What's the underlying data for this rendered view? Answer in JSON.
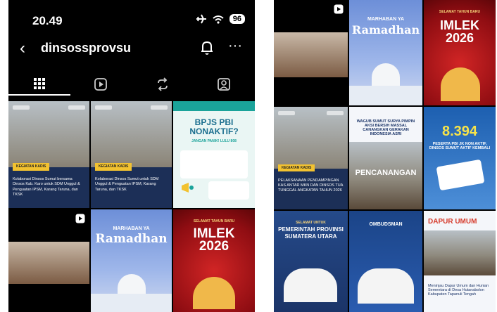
{
  "status": {
    "time": "20.49",
    "battery": "96"
  },
  "header": {
    "username": "dinsossprovsu"
  },
  "tabs": [
    {
      "name": "grid-icon"
    },
    {
      "name": "reels-icon"
    },
    {
      "name": "repost-icon"
    },
    {
      "name": "tagged-icon"
    }
  ],
  "posts": {
    "kegiatan_label": "KEGIATAN KADIS",
    "post1_caption": "Kolaborasi Dinsos Sumut bersama Dinsos Kab. Karo untuk SDM Unggul & Penguatan IPSM, Karang Taruna, dan TKSK",
    "post2_caption": "Kolaborasi Dinsos Sumut untuk SDM Unggul & Penguatan IPSM, Karang Taruna, dan TKSK",
    "bpjs_title": "BPJS PBI NONAKTIF?",
    "bpjs_sub": "JANGAN PANIK! LULU 808",
    "marhaban_1": "MARHABAN YA",
    "marhaban_2": "Ramadhan",
    "imlek_header": "SELAMAT TAHUN BARU",
    "imlek_word": "IMLEK",
    "imlek_year": "2026",
    "wamen_title": "WAGUB SUMUT SURYA PIMPIN AKSI BERSIH MASSAL CANANGKAN GERAKAN INDONESIA ASRI",
    "pencanangan": "PENCANANGAN",
    "stat_value": "8.394",
    "stat_caption": "PESERTA PBI JK NON AKTIF, DINSOS SUMUT AKTIF KEMBALI",
    "pelaksanaan_caption": "PELAKSANAAN PENDAMPINGAN KAS ANTAR MKN DAN DINSOS TUA TUNGGAL ANGKATAN TAHUN 2026",
    "pemprov_1": "SELAMAT UNTUK",
    "pemprov_2": "PEMERINTAH PROVINSI",
    "pemprov_3": "SUMATERA UTARA",
    "ombudsman": "OMBUDSMAN",
    "dapur_title": "DAPUR UMUM",
    "dapur_caption": "Meninjau Dapur Umum dan Hunian Sementara di Desa Hutanabolon Kabupaten Tapanuli Tengah"
  }
}
